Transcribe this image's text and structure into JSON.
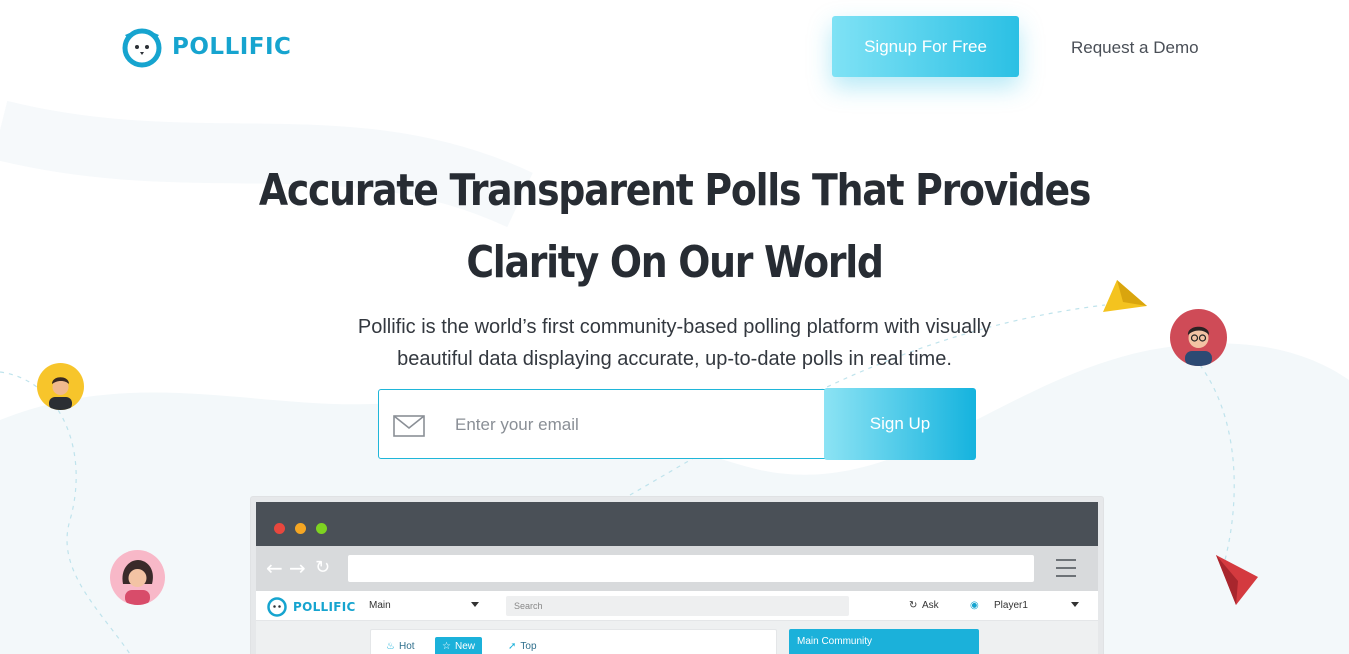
{
  "header": {
    "brand": "POLLIFIC",
    "signup_free_label": "Signup For Free",
    "request_demo_label": "Request a Demo"
  },
  "hero": {
    "title_line1": "Accurate Transparent Polls That Provides",
    "title_line2": "Clarity On Our World",
    "subtitle_line1": "Pollific is the world’s first community-based polling platform with visually",
    "subtitle_line2": "beautiful data displaying accurate, up-to-date polls in real time.",
    "email_placeholder": "Enter your email",
    "signup_label": "Sign Up"
  },
  "mockup": {
    "brand": "POLLIFIC",
    "community_select": "Main",
    "search_placeholder": "Search",
    "ask_label": "Ask",
    "user_name": "Player1",
    "tabs": [
      {
        "label": "Hot",
        "icon": "flame-icon"
      },
      {
        "label": "New",
        "icon": "star-icon"
      },
      {
        "label": "Top",
        "icon": "rocket-icon"
      }
    ],
    "side_panel_title": "Main Community"
  },
  "colors": {
    "accent": "#1bb1da",
    "title": "#272c33",
    "browser_bar": "#4a5057"
  }
}
